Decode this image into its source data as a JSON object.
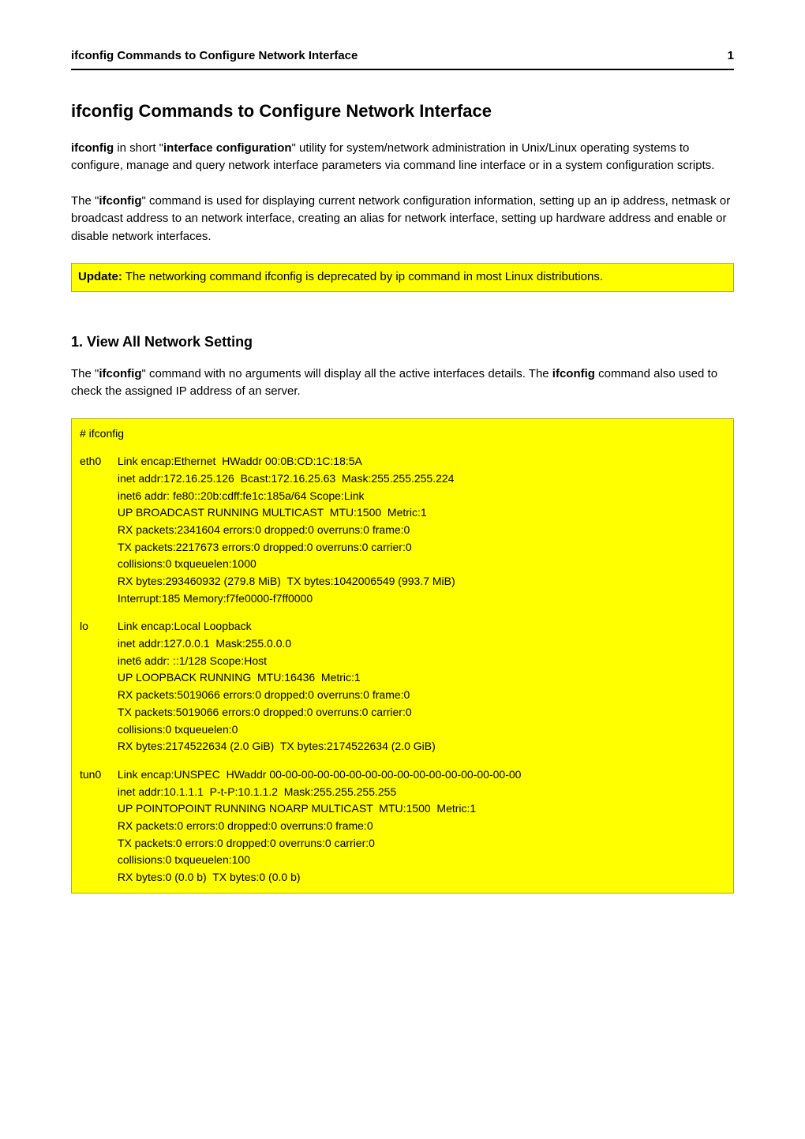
{
  "header": {
    "title": "ifconfig Commands to Configure Network Interface",
    "page": "1"
  },
  "main_title": "ifconfig Commands to Configure Network Interface",
  "intro": {
    "p1_pre": "ifconfig",
    "p1_mid": " in short \"",
    "p1_bold2": "interface configuration",
    "p1_post": "\" utility for system/network administration in Unix/Linux operating systems to configure, manage and query network interface parameters via command line interface or in a system configuration scripts."
  },
  "para2": {
    "pre": "The \"",
    "bold": "ifconfig",
    "post": "\" command is used for displaying current network configuration information, setting up an ip address, netmask or broadcast address to an network interface, creating an alias for network interface, setting up hardware address and enable or disable network interfaces."
  },
  "callout": {
    "bold": "Update:",
    "text": " The networking command ifconfig is deprecated by ip command in most Linux distributions."
  },
  "section1": {
    "title": "1. View All Network Setting",
    "desc_pre": "The \"",
    "desc_bold1": "ifconfig",
    "desc_mid": "\" command with no arguments will display all the active interfaces details. The ",
    "desc_bold2": "ifconfig",
    "desc_post": " command also used to check the assigned IP address of an server."
  },
  "code": {
    "cmd": "# ifconfig",
    "eth0": {
      "label": "eth0",
      "lines": [
        "Link encap:Ethernet  HWaddr 00:0B:CD:1C:18:5A",
        "inet addr:172.16.25.126  Bcast:172.16.25.63  Mask:255.255.255.224",
        "inet6 addr: fe80::20b:cdff:fe1c:185a/64 Scope:Link",
        "UP BROADCAST RUNNING MULTICAST  MTU:1500  Metric:1",
        "RX packets:2341604 errors:0 dropped:0 overruns:0 frame:0",
        "TX packets:2217673 errors:0 dropped:0 overruns:0 carrier:0",
        "collisions:0 txqueuelen:1000",
        "RX bytes:293460932 (279.8 MiB)  TX bytes:1042006549 (993.7 MiB)",
        "Interrupt:185 Memory:f7fe0000-f7ff0000"
      ]
    },
    "lo": {
      "label": "lo",
      "lines": [
        "Link encap:Local Loopback",
        "inet addr:127.0.0.1  Mask:255.0.0.0",
        "inet6 addr: ::1/128 Scope:Host",
        "UP LOOPBACK RUNNING  MTU:16436  Metric:1",
        "RX packets:5019066 errors:0 dropped:0 overruns:0 frame:0",
        "TX packets:5019066 errors:0 dropped:0 overruns:0 carrier:0",
        "collisions:0 txqueuelen:0",
        "RX bytes:2174522634 (2.0 GiB)  TX bytes:2174522634 (2.0 GiB)"
      ]
    },
    "tun0": {
      "label": "tun0",
      "lines": [
        "Link encap:UNSPEC  HWaddr 00-00-00-00-00-00-00-00-00-00-00-00-00-00-00-00",
        "inet addr:10.1.1.1  P-t-P:10.1.1.2  Mask:255.255.255.255",
        "UP POINTOPOINT RUNNING NOARP MULTICAST  MTU:1500  Metric:1",
        "RX packets:0 errors:0 dropped:0 overruns:0 frame:0",
        "TX packets:0 errors:0 dropped:0 overruns:0 carrier:0",
        "collisions:0 txqueuelen:100",
        "RX bytes:0 (0.0 b)  TX bytes:0 (0.0 b)"
      ]
    }
  }
}
